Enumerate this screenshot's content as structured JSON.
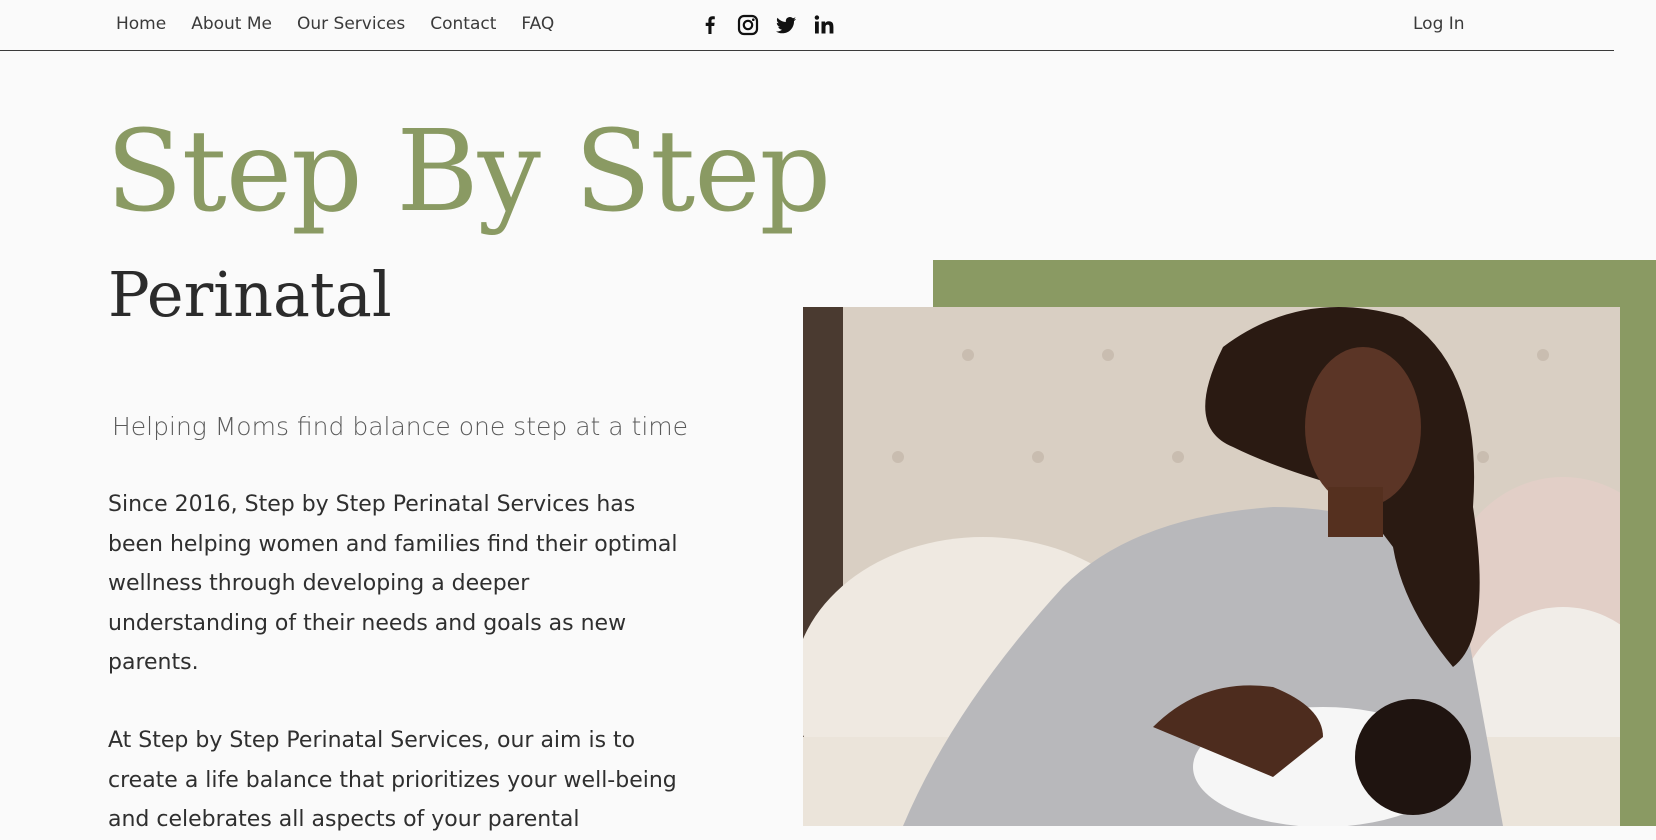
{
  "nav": {
    "links": [
      "Home",
      "About Me",
      "Our Services",
      "Contact",
      "FAQ"
    ],
    "login": "Log In",
    "social_icons": [
      "facebook-icon",
      "instagram-icon",
      "twitter-icon",
      "linkedin-icon"
    ]
  },
  "hero": {
    "title": "Step By Step",
    "subtitle": "Perinatal",
    "tagline": "Helping Moms find balance one step at a time",
    "paragraph1": "Since 2016, Step by Step Perinatal Services has been helping women and families find their optimal wellness through developing a deeper understanding of their needs and goals as new parents.",
    "paragraph2": "At Step by Step Perinatal Services, our aim is to create a life balance that prioritizes your well-being and celebrates all aspects of your parental"
  },
  "colors": {
    "accent": "#8a9a63",
    "text": "#2b2b2b",
    "background": "#fafafa"
  }
}
